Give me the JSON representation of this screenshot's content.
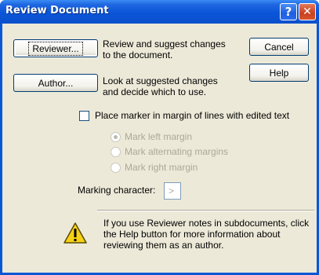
{
  "window": {
    "title": "Review Document"
  },
  "titlebar": {
    "help_label": "?",
    "close_label": "✕"
  },
  "buttons": {
    "reviewer": {
      "label": "Reviewer..."
    },
    "author": {
      "label": "Author..."
    },
    "cancel": {
      "label": "Cancel"
    },
    "help": {
      "label": "Help"
    }
  },
  "descriptions": {
    "reviewer": "Review and suggest changes\nto the document.",
    "author": "Look at suggested changes\nand decide which to use."
  },
  "place_marker": {
    "label": "Place marker in margin of lines with edited text",
    "checked": false
  },
  "margin_options": [
    {
      "label": "Mark left margin",
      "selected": true
    },
    {
      "label": "Mark alternating margins",
      "selected": false
    },
    {
      "label": "Mark right margin",
      "selected": false
    }
  ],
  "marking_character": {
    "label": "Marking character:",
    "value": ">"
  },
  "info_text": "If you use Reviewer notes in subdocuments, click the Help button for more information about reviewing them as an author.",
  "icons": {
    "warning": "warning-icon"
  }
}
